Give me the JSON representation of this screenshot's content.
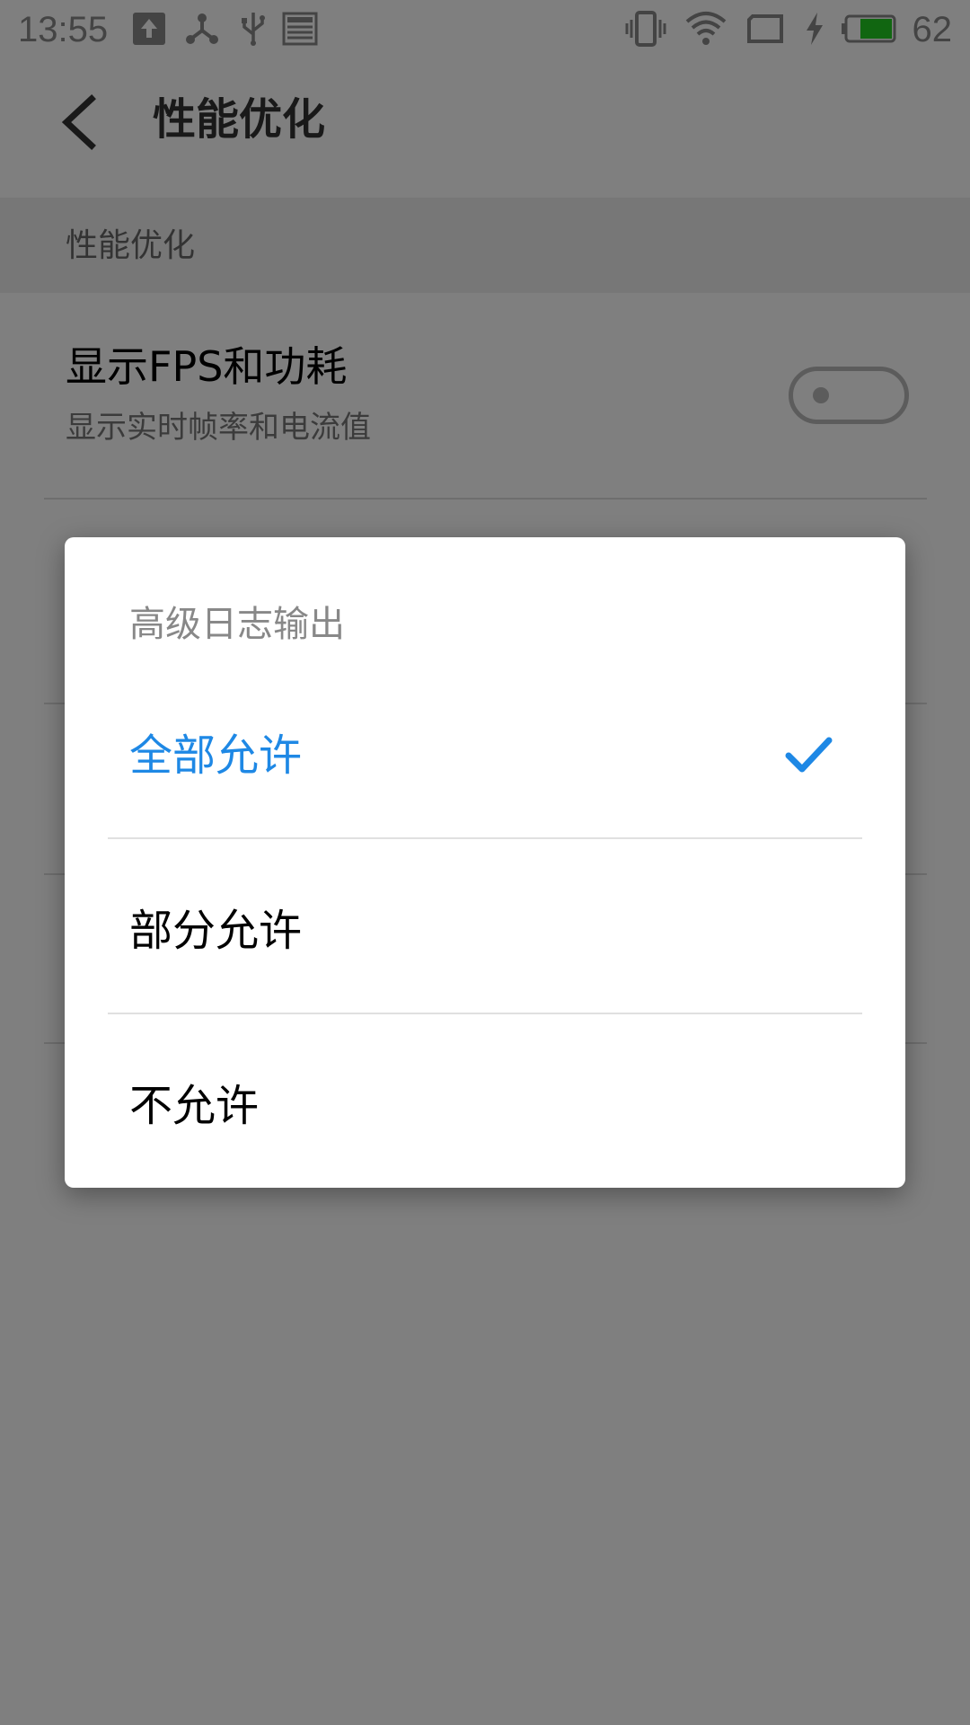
{
  "status_bar": {
    "time": "13:55",
    "battery_level": "62",
    "icons": [
      "upload-icon",
      "share-icon",
      "usb-icon",
      "news-icon",
      "vibrate-icon",
      "wifi-icon",
      "screen-icon",
      "charging-icon",
      "battery-icon"
    ],
    "battery_fill_color": "#22cc22"
  },
  "toolbar": {
    "title": "性能优化",
    "back_icon": "chevron-left-icon"
  },
  "section": {
    "header": "性能优化"
  },
  "settings": [
    {
      "title": "显示FPS和功耗",
      "summary": "显示实时帧率和电流值",
      "toggle_on": false
    }
  ],
  "dialog": {
    "title": "高级日志输出",
    "options": [
      {
        "label": "全部允许",
        "selected": true
      },
      {
        "label": "部分允许",
        "selected": false
      },
      {
        "label": "不允许",
        "selected": false
      }
    ],
    "accent_color": "#1e88e5"
  }
}
